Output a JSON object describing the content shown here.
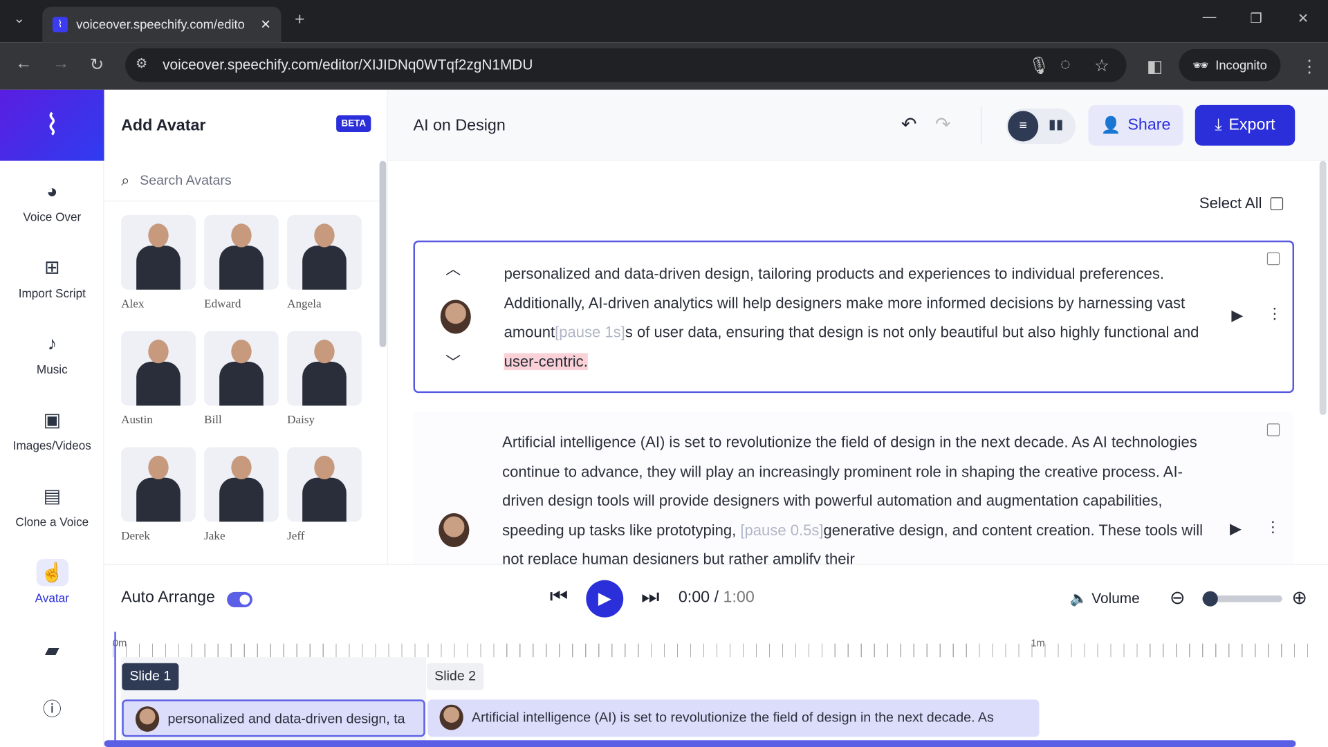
{
  "browser": {
    "tab_title": "voiceover.speechify.com/edito",
    "url": "voiceover.speechify.com/editor/XIJIDNq0WTqf2zgN1MDU",
    "profile": "Incognito"
  },
  "nav": {
    "items": [
      {
        "label": "Voice Over"
      },
      {
        "label": "Import Script"
      },
      {
        "label": "Music"
      },
      {
        "label": "Images/Videos"
      },
      {
        "label": "Clone a Voice"
      },
      {
        "label": "Avatar"
      }
    ]
  },
  "panel": {
    "title": "Add Avatar",
    "badge": "BETA",
    "search_placeholder": "Search Avatars",
    "avatars": [
      {
        "name": "Alex"
      },
      {
        "name": "Edward"
      },
      {
        "name": "Angela"
      },
      {
        "name": "Austin"
      },
      {
        "name": "Bill"
      },
      {
        "name": "Daisy"
      },
      {
        "name": "Derek"
      },
      {
        "name": "Jake"
      },
      {
        "name": "Jeff"
      }
    ]
  },
  "header": {
    "doc_title": "AI on Design",
    "share": "Share",
    "export": "Export"
  },
  "main": {
    "select_all": "Select All",
    "block1": {
      "t1": "personalized and data-driven design, tailoring products and experiences to individual preferences. Additionally, AI-driven analytics will help designers make more informed decisions by harnessing vast amount",
      "p1": "[pause 1s]",
      "t2": "s of user data, ensuring that design is not only beautiful but also highly functional and ",
      "hl": "user-centric."
    },
    "block2": {
      "t1": "Artificial intelligence (AI) is set to revolutionize the field of design in the next decade. As AI technologies continue to advance, they will play an increasingly prominent role in shaping the creative process. AI-driven design tools will provide designers with powerful automation and augmentation capabilities, speeding up tasks like prototyping, ",
      "p1": "[pause 0.5s]",
      "t2": "generative design, and content creation. These tools will not replace human designers but rather amplify their"
    }
  },
  "player": {
    "auto_arrange": "Auto Arrange",
    "auto_arrange_on": true,
    "time_current": "0:00",
    "time_sep": " / ",
    "time_total": "1:00",
    "volume": "Volume",
    "zoom_level": 0.05
  },
  "timeline": {
    "mark0": "0m",
    "mark1": "1m",
    "slides": [
      {
        "label": "Slide 1",
        "clip": "personalized and data-driven design, ta"
      },
      {
        "label": "Slide 2",
        "clip": "Artificial intelligence (AI) is set to revolutionize the field of design in the next decade. As"
      }
    ]
  },
  "colors": {
    "accent": "#2b2fd9",
    "highlight": "#f9d1d6"
  }
}
